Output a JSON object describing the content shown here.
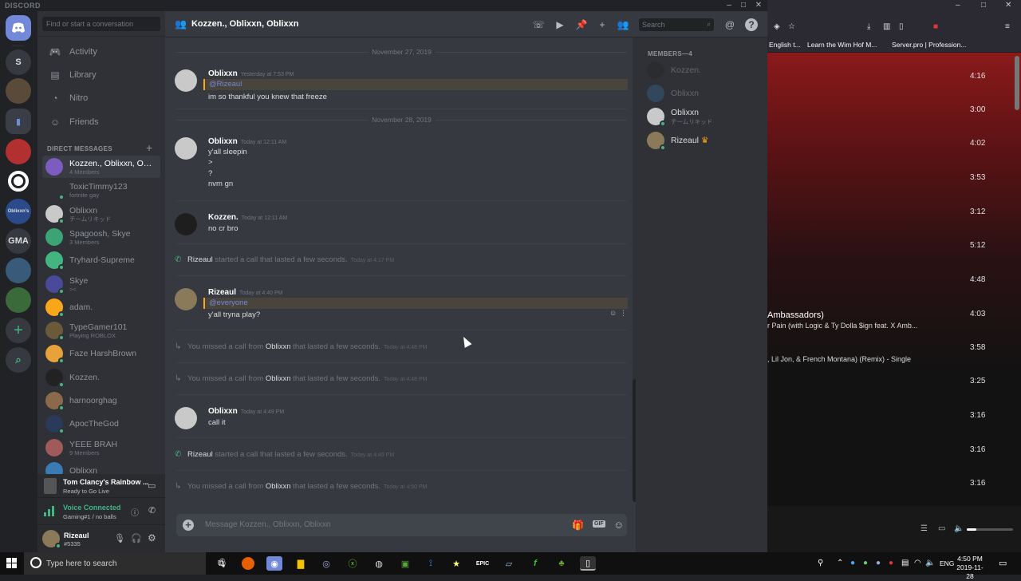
{
  "titlebar": {
    "brand": "DISCORD"
  },
  "guilds": [
    {
      "label": "S"
    },
    {
      "label": "GMA"
    }
  ],
  "sidebar": {
    "search_placeholder": "Find or start a conversation",
    "nav": [
      {
        "label": "Activity",
        "icon": "controller-icon"
      },
      {
        "label": "Library",
        "icon": "library-icon"
      },
      {
        "label": "Nitro",
        "icon": "nitro-icon"
      },
      {
        "label": "Friends",
        "icon": "friends-icon"
      }
    ],
    "dm_header": "DIRECT MESSAGES",
    "dms": [
      {
        "name": "Kozzen., Oblixxn, Obl...",
        "sub": "4 Members",
        "color": "#7c5cbf",
        "active": true
      },
      {
        "name": "ToxicTimmy123",
        "sub": "fortnite gay",
        "color": "#2f3136"
      },
      {
        "name": "Oblixxn",
        "sub": "チームリキッド",
        "color": "#c9c9c9"
      },
      {
        "name": "Spagoosh, Skye",
        "sub": "3 Members",
        "color": "#3ca374"
      },
      {
        "name": "Tryhard-Supreme",
        "sub": "",
        "color": "#43b581"
      },
      {
        "name": "Skye",
        "sub": "><",
        "color": "#4a4a9a"
      },
      {
        "name": "adam.",
        "sub": "",
        "color": "#faa61a"
      },
      {
        "name": "TypeGamer101",
        "sub": "Playing ROBLOX",
        "color": "#6b5a3a"
      },
      {
        "name": "Faze HarshBrown",
        "sub": "",
        "color": "#e8a23a"
      },
      {
        "name": "Kozzen.",
        "sub": "",
        "color": "#222"
      },
      {
        "name": "harnoorghag",
        "sub": "",
        "color": "#8a6a4a"
      },
      {
        "name": "ApocTheGod",
        "sub": "",
        "color": "#2a3a5a"
      },
      {
        "name": "YEEE BRAH",
        "sub": "9 Members",
        "color": "#a05a5a"
      },
      {
        "name": "Oblixxn",
        "sub": "",
        "color": "#3a7ab5"
      }
    ],
    "game": {
      "title": "Tom Clancy's Rainbow ...",
      "sub": "Ready to Go Live"
    },
    "voice": {
      "status": "Voice Connected",
      "channel": "Gaming#1 / no balls"
    },
    "user": {
      "name": "Rizeaul",
      "tag": "#5335"
    }
  },
  "chat": {
    "title": "Kozzen., Oblixxn, Oblixxn",
    "search_placeholder": "Search",
    "composer_placeholder": "Message Kozzen., Oblixxn, Oblixxn",
    "dividers": [
      "November 27, 2019",
      "November 28, 2019"
    ],
    "messages": [
      {
        "author": "Oblixxn",
        "time": "Yesterday at 7:53 PM",
        "mention": "@Rizeaul",
        "lines": [
          "im so thankful you knew that freeze"
        ]
      },
      {
        "author": "Oblixxn",
        "time": "Today at 12:11 AM",
        "lines": [
          "y'all sleepin",
          ">",
          "?",
          "nvm gn"
        ]
      },
      {
        "author": "Kozzen.",
        "time": "Today at 12:11 AM",
        "lines": [
          "no cr bro"
        ]
      },
      {
        "author": "Rizeaul",
        "time": "Today at 4:40 PM",
        "mention": "@everyone",
        "lines": [
          "y'all tryna play?"
        ]
      },
      {
        "author": "Oblixxn",
        "time": "Today at 4:49 PM",
        "lines": [
          "call it"
        ]
      }
    ],
    "system": [
      {
        "who": "Rizeaul",
        "text": " started a call that lasted a few seconds.",
        "time": "Today at 4:17 PM",
        "kind": "start"
      },
      {
        "pre": "You missed a call from ",
        "who": "Oblixxn",
        "text": " that lasted a few seconds.",
        "time": "Today at 4:48 PM",
        "kind": "missed"
      },
      {
        "pre": "You missed a call from ",
        "who": "Oblixxn",
        "text": " that lasted a few seconds.",
        "time": "Today at 4:48 PM",
        "kind": "missed"
      },
      {
        "who": "Rizeaul",
        "text": " started a call that lasted a few seconds.",
        "time": "Today at 4:49 PM",
        "kind": "start"
      },
      {
        "pre": "You missed a call from ",
        "who": "Oblixxn",
        "text": " that lasted a few seconds.",
        "time": "Today at 4:50 PM",
        "kind": "missed"
      }
    ]
  },
  "members": {
    "header": "MEMBERS—4",
    "list": [
      {
        "name": "Kozzen.",
        "sub": "",
        "offline": true,
        "color": "#222"
      },
      {
        "name": "Oblixxn",
        "sub": "",
        "offline": true,
        "color": "#3a7ab5"
      },
      {
        "name": "Oblixxn",
        "sub": "チームリキッド",
        "offline": false,
        "color": "#c9c9c9"
      },
      {
        "name": "Rizeaul",
        "sub": "",
        "offline": false,
        "color": "#8a7a5a",
        "crown": true
      }
    ]
  },
  "browser": {
    "bookmarks": [
      "English t...",
      "Learn the Wim Hof M...",
      "Server.pro | Profession..."
    ],
    "durations": [
      "4:16",
      "3:00",
      "4:02",
      "3:53",
      "3:12",
      "5:12",
      "4:48",
      "4:03",
      "3:58",
      "3:25",
      "3:16",
      "3:16",
      "3:16"
    ],
    "tracks": [
      "Ambassadors)",
      "r Pain (with Logic & Ty Dolla $ign feat. X Amb...",
      ", Lil Jon, & French Montana) (Remix) - Single"
    ]
  },
  "taskbar": {
    "search_placeholder": "Type here to search",
    "lang": "ENG",
    "time": "4:50 PM",
    "date": "2019-11-28"
  }
}
